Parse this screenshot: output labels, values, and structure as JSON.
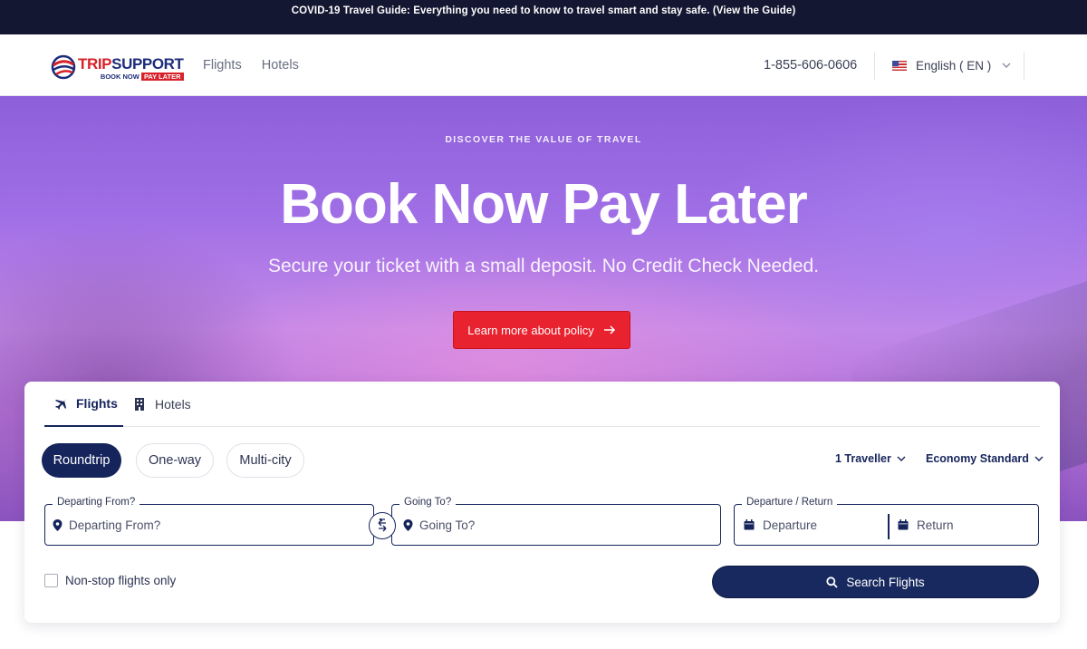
{
  "banner": {
    "text": "COVID-19 Travel Guide: Everything you need to know to travel smart and stay safe. (View the Guide)"
  },
  "header": {
    "logo": {
      "brand_left": "TRIP",
      "brand_right": "SUPPORT",
      "tagline_left": "BOOK NOW",
      "tagline_right": "PAY LATER"
    },
    "nav": [
      {
        "label": "Flights"
      },
      {
        "label": "Hotels"
      }
    ],
    "phone": "1-855-606-0606",
    "language": {
      "label": "English ( EN )",
      "flag": "us-flag-icon"
    }
  },
  "hero": {
    "eyebrow": "DISCOVER THE VALUE OF TRAVEL",
    "title": "Book Now Pay Later",
    "subtitle": "Secure your ticket with a small deposit. No Credit Check Needed.",
    "cta_label": "Learn more about policy"
  },
  "search": {
    "tabs": [
      {
        "label": "Flights",
        "icon": "plane-icon",
        "active": true
      },
      {
        "label": "Hotels",
        "icon": "building-icon",
        "active": false
      }
    ],
    "trip_types": [
      {
        "label": "Roundtrip",
        "selected": true
      },
      {
        "label": "One-way",
        "selected": false
      },
      {
        "label": "Multi-city",
        "selected": false
      }
    ],
    "travellers": "1 Traveller",
    "cabin_class": "Economy Standard",
    "departing": {
      "label": "Departing From?",
      "placeholder": "Departing From?"
    },
    "going_to": {
      "label": "Going To?",
      "placeholder": "Going To?"
    },
    "dates": {
      "label": "Departure / Return",
      "departure_placeholder": "Departure",
      "return_placeholder": "Return"
    },
    "nonstop_label": "Non-stop flights only",
    "nonstop_checked": false,
    "search_button": "Search Flights"
  },
  "colors": {
    "banner_bg": "#141732",
    "primary_navy": "#16245c",
    "cta_red": "#e8222e",
    "brand_red": "#d7222a",
    "hero_purple": "#a06fe6"
  }
}
